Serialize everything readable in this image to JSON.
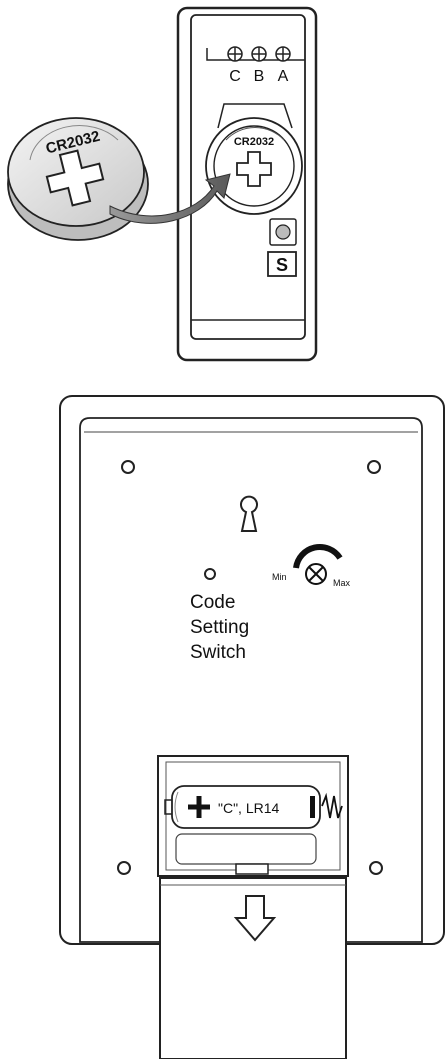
{
  "transmitter": {
    "terminals": [
      "C",
      "B",
      "A"
    ],
    "coin_cell_label": "CR2032",
    "holder_cell_label": "CR2032",
    "switch_label": "S"
  },
  "receiver": {
    "knob_min_label": "Min",
    "knob_max_label": "Max",
    "code_switch_label": [
      "Code",
      "Setting",
      "Switch"
    ],
    "battery_label": "\"C\", LR14"
  }
}
